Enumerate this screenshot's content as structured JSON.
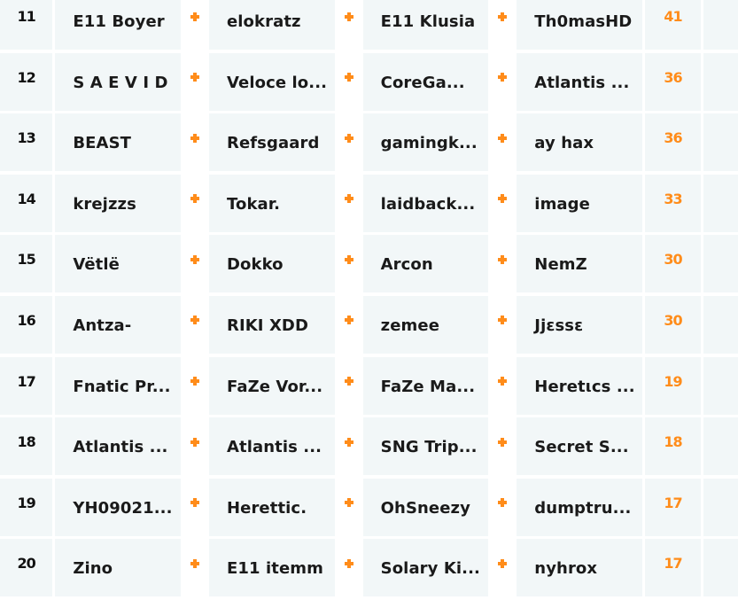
{
  "accent_color": "#ff8c1a",
  "cell_background": "#f2f7f8",
  "separator_icon": "plus-icon",
  "rows": [
    {
      "rank": "11",
      "players": [
        "E11 Boyer",
        "elokratz",
        "E11 Klusia",
        "Th0masHD"
      ],
      "score": "41"
    },
    {
      "rank": "12",
      "players": [
        "S A E V I D",
        "Veloce lo...",
        "CoreGa...",
        "Atlantis ..."
      ],
      "score": "36"
    },
    {
      "rank": "13",
      "players": [
        "BEAST",
        "Refsgaard",
        "gamingk...",
        "ay hax"
      ],
      "score": "36"
    },
    {
      "rank": "14",
      "players": [
        "krejzzs",
        "Tokar.",
        "laidback...",
        "image"
      ],
      "score": "33"
    },
    {
      "rank": "15",
      "players": [
        "Vëtlë",
        "Dokko",
        "Arcon",
        "NemZ"
      ],
      "score": "30"
    },
    {
      "rank": "16",
      "players": [
        "Antza-",
        "RIKI XDD",
        "zemee",
        "Jjɛssɛ"
      ],
      "score": "30"
    },
    {
      "rank": "17",
      "players": [
        "Fnatic Pr...",
        "FaZe Vor...",
        "FaZe Ma...",
        "Heretιcs ..."
      ],
      "score": "19"
    },
    {
      "rank": "18",
      "players": [
        "Atlantis ...",
        "Atlantis ...",
        "SNG Trip...",
        "Secret S..."
      ],
      "score": "18"
    },
    {
      "rank": "19",
      "players": [
        "YH09021...",
        "Herettic.",
        "OhSneezy",
        "dumptru..."
      ],
      "score": "17"
    },
    {
      "rank": "20",
      "players": [
        "Zino",
        "E11 itemm",
        "Solary Ki...",
        "nyhrox"
      ],
      "score": "17"
    }
  ]
}
